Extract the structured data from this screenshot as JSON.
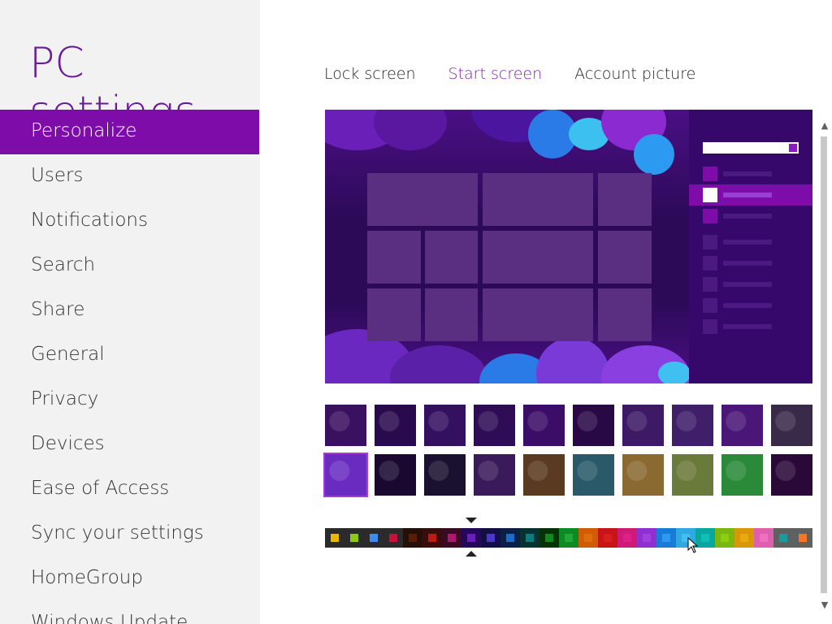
{
  "app": {
    "title": "PC settings"
  },
  "nav": {
    "items": [
      {
        "label": "Personalize",
        "selected": true
      },
      {
        "label": "Users"
      },
      {
        "label": "Notifications"
      },
      {
        "label": "Search"
      },
      {
        "label": "Share"
      },
      {
        "label": "General"
      },
      {
        "label": "Privacy"
      },
      {
        "label": "Devices"
      },
      {
        "label": "Ease of Access"
      },
      {
        "label": "Sync your settings"
      },
      {
        "label": "HomeGroup"
      },
      {
        "label": "Windows Update"
      }
    ]
  },
  "tabs": [
    {
      "label": "Lock screen"
    },
    {
      "label": "Start screen",
      "active": true
    },
    {
      "label": "Account picture"
    }
  ],
  "colors": {
    "accent": "#7e0ca8",
    "title": "#6a1b9a",
    "tab_active": "#7e20b8",
    "nav_background": "#f2f2f2"
  },
  "backgrounds": {
    "row1": [
      "#3a1060",
      "#2a0a4e",
      "#341060",
      "#2e0c56",
      "#3b0d67",
      "#280845",
      "#3d1966",
      "#3f1e6a",
      "#4a1678",
      "#3a2a4a"
    ],
    "row2": [
      "#6a2cc0",
      "#1a0830",
      "#1a1030",
      "#3a1a5a",
      "#5a3a20",
      "#2a5a6a",
      "#8a6a30",
      "#6a7a3a",
      "#2a8a3a",
      "#2a0838"
    ],
    "selected_index": 10
  },
  "palette": {
    "selected_index": 7,
    "swatches": [
      "#e8b800",
      "#8cc71a",
      "#3a8ef0",
      "#c0143c",
      "#5a1e08",
      "#b81e12",
      "#b01870",
      "#6a1fb8",
      "#4a36c8",
      "#1e6ac8",
      "#0a7e7e",
      "#108a20",
      "#20a838",
      "#e06c10",
      "#d81e1e",
      "#e0208a",
      "#a040e0",
      "#2c9af0",
      "#40c0f0",
      "#10c0b8",
      "#8ad010",
      "#e8a810",
      "#f070c0",
      "#1a9aa0",
      "#f07828"
    ],
    "cell_backgrounds": [
      "#2b2b2b",
      "#2b2b2b",
      "#2b2b2b",
      "#2b2b2b",
      "#241008",
      "#3a0c0c",
      "#3a0a22",
      "#26085a",
      "#140e48",
      "#0a2048",
      "#073232",
      "#073207",
      "#0e8a24",
      "#d05c08",
      "#c81414",
      "#d01a78",
      "#9030d0",
      "#1a7ad8",
      "#30a8e0",
      "#08a8a0",
      "#7ab810",
      "#d89808",
      "#e060b0",
      "#606060",
      "#606060"
    ]
  }
}
